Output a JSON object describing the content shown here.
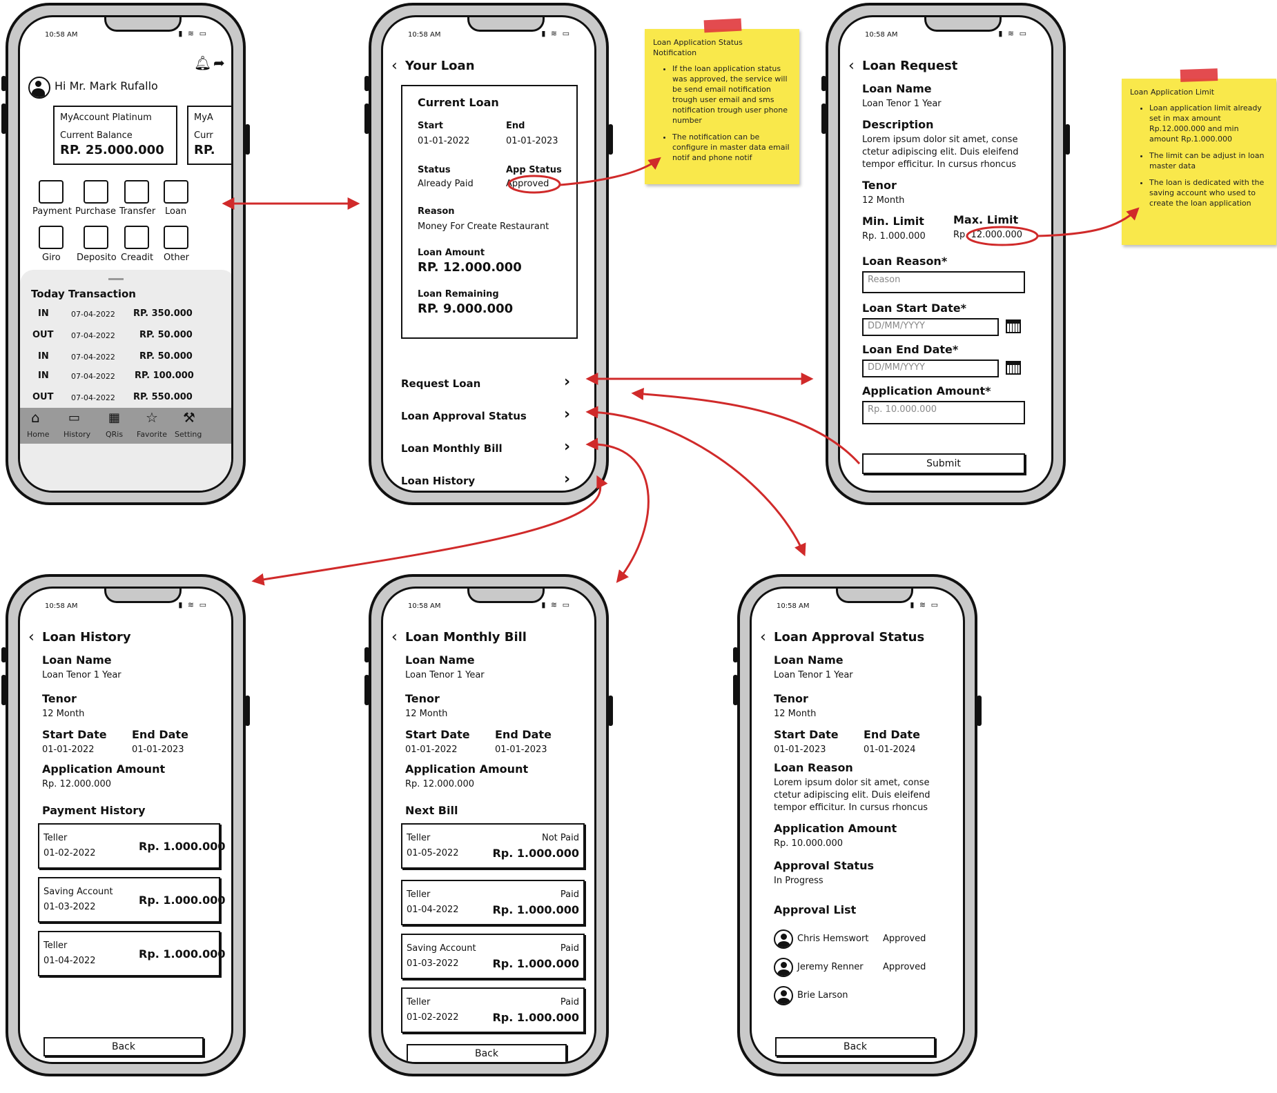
{
  "status_time": "10:58 AM",
  "home": {
    "greeting": "Hi Mr. Mark Rufallo",
    "card1_title": "MyAccount Platinum",
    "card1_label": "Current Balance",
    "card1_amount": "RP. 25.000.000",
    "card2_title": "MyA",
    "card2_label": "Curr",
    "card2_amount": "RP.",
    "menu_row1": [
      "Payment",
      "Purchase",
      "Transfer",
      "Loan"
    ],
    "menu_row2": [
      "Giro",
      "Deposito",
      "Creadit",
      "Other"
    ],
    "today_title": "Today Transaction",
    "transactions": [
      {
        "type": "IN",
        "date": "07-04-2022",
        "amount": "RP. 350.000"
      },
      {
        "type": "OUT",
        "date": "07-04-2022",
        "amount": "RP. 50.000"
      },
      {
        "type": "IN",
        "date": "07-04-2022",
        "amount": "RP. 50.000"
      },
      {
        "type": "IN",
        "date": "07-04-2022",
        "amount": "RP. 100.000"
      },
      {
        "type": "OUT",
        "date": "07-04-2022",
        "amount": "RP. 550.000"
      }
    ],
    "nav": [
      "Home",
      "History",
      "QRis",
      "Favorite",
      "Setting"
    ]
  },
  "your_loan": {
    "title": "Your Loan",
    "card_title": "Current Loan",
    "start_label": "Start",
    "start_value": "01-01-2022",
    "end_label": "End",
    "end_value": "01-01-2023",
    "status_label": "Status",
    "status_value": "Already Paid",
    "app_status_label": "App Status",
    "app_status_value": "Approved",
    "reason_label": "Reason",
    "reason_value": "Money For Create Restaurant",
    "amount_label": "Loan Amount",
    "amount_value": "RP. 12.000.000",
    "remaining_label": "Loan Remaining",
    "remaining_value": "RP. 9.000.000",
    "menu": [
      "Request Loan",
      "Loan Approval Status",
      "Loan Monthly Bill",
      "Loan History"
    ]
  },
  "loan_request": {
    "title": "Loan Request",
    "loan_name_label": "Loan Name",
    "loan_name_value": "Loan Tenor 1 Year",
    "desc_label": "Description",
    "desc_lines": [
      "Lorem ipsum dolor sit amet, conse",
      "ctetur adipiscing elit. Duis eleifend",
      "tempor efficitur. In cursus rhoncus"
    ],
    "tenor_label": "Tenor",
    "tenor_value": "12 Month",
    "min_label": "Min. Limit",
    "min_value": "Rp. 1.000.000",
    "max_label": "Max. Limit",
    "max_value": "Rp. 12.000.000",
    "reason_label": "Loan Reason*",
    "reason_placeholder": "Reason",
    "start_label": "Loan Start Date*",
    "start_placeholder": "DD/MM/YYYY",
    "end_label": "Loan End Date*",
    "end_placeholder": "DD/MM/YYYY",
    "amount_label": "Application Amount*",
    "amount_placeholder": "Rp. 10.000.000",
    "submit": "Submit"
  },
  "notes": {
    "status_title": "Loan Application Status Notification",
    "status_items": [
      "If the loan application status was approved, the service will be send email notification trough user email and sms notification trough user phone number",
      "The notification can be configure in master data email notif and phone notif"
    ],
    "limit_title": "Loan Application Limit",
    "limit_items": [
      "Loan application limit already set in max amount Rp.12.000.000 and min amount Rp.1.000.000",
      "The limit can be adjust in loan master data",
      "The loan is dedicated with the saving account who used to create the loan application"
    ]
  },
  "loan_history": {
    "title": "Loan History",
    "loan_name_label": "Loan Name",
    "loan_name_value": "Loan Tenor 1 Year",
    "tenor_label": "Tenor",
    "tenor_value": "12 Month",
    "start_label": "Start Date",
    "start_value": "01-01-2022",
    "end_label": "End Date",
    "end_value": "01-01-2023",
    "amount_label": "Application Amount",
    "amount_value": "Rp. 12.000.000",
    "payment_title": "Payment History",
    "payments": [
      {
        "method": "Teller",
        "date": "01-02-2022",
        "amount": "Rp. 1.000.000"
      },
      {
        "method": "Saving Account",
        "date": "01-03-2022",
        "amount": "Rp. 1.000.000"
      },
      {
        "method": "Teller",
        "date": "01-04-2022",
        "amount": "Rp. 1.000.000"
      }
    ],
    "back": "Back"
  },
  "monthly_bill": {
    "title": "Loan Monthly Bill",
    "loan_name_label": "Loan Name",
    "loan_name_value": "Loan Tenor 1 Year",
    "tenor_label": "Tenor",
    "tenor_value": "12 Month",
    "start_label": "Start Date",
    "start_value": "01-01-2022",
    "end_label": "End Date",
    "end_value": "01-01-2023",
    "amount_label": "Application Amount",
    "amount_value": "Rp. 12.000.000",
    "next_title": "Next Bill",
    "bills": [
      {
        "method": "Teller",
        "status": "Not Paid",
        "date": "01-05-2022",
        "amount": "Rp. 1.000.000"
      },
      {
        "method": "Teller",
        "status": "Paid",
        "date": "01-04-2022",
        "amount": "Rp. 1.000.000"
      },
      {
        "method": "Saving Account",
        "status": "Paid",
        "date": "01-03-2022",
        "amount": "Rp. 1.000.000"
      },
      {
        "method": "Teller",
        "status": "Paid",
        "date": "01-02-2022",
        "amount": "Rp. 1.000.000"
      }
    ],
    "back": "Back"
  },
  "approval": {
    "title": "Loan Approval Status",
    "loan_name_label": "Loan Name",
    "loan_name_value": "Loan Tenor 1 Year",
    "tenor_label": "Tenor",
    "tenor_value": "12 Month",
    "start_label": "Start Date",
    "start_value": "01-01-2023",
    "end_label": "End Date",
    "end_value": "01-01-2024",
    "reason_label": "Loan Reason",
    "reason_lines": [
      "Lorem ipsum dolor sit amet, conse",
      "ctetur adipiscing elit. Duis eleifend",
      "tempor efficitur. In cursus rhoncus"
    ],
    "amount_label": "Application Amount",
    "amount_value": "Rp. 10.000.000",
    "status_label": "Approval Status",
    "status_value": "In Progress",
    "list_title": "Approval List",
    "approvers": [
      {
        "name": "Chris Hemswort",
        "status": "Approved"
      },
      {
        "name": "Jeremy Renner",
        "status": "Approved"
      },
      {
        "name": "Brie Larson",
        "status": ""
      }
    ],
    "back": "Back"
  },
  "colors": {
    "arrow": "#d02a2a",
    "sticky": "#f9e84b",
    "tape": "#e0373c",
    "phone_frame": "#c9c9c9"
  }
}
